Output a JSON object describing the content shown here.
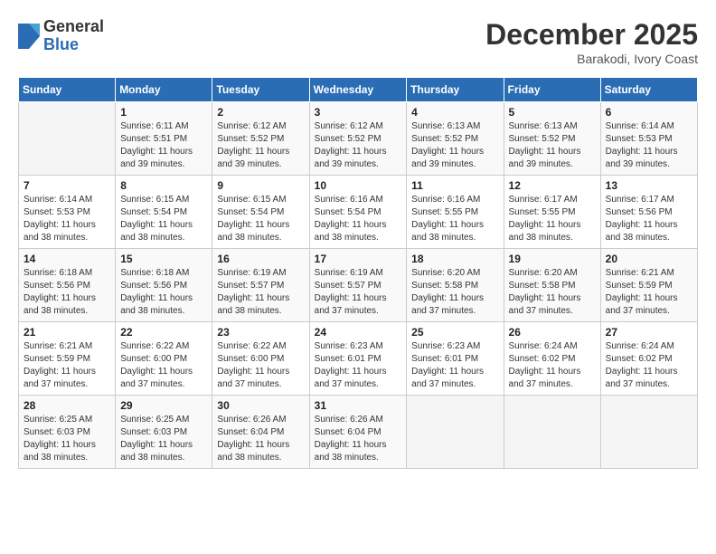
{
  "logo": {
    "general": "General",
    "blue": "Blue"
  },
  "header": {
    "month": "December 2025",
    "location": "Barakodi, Ivory Coast"
  },
  "weekdays": [
    "Sunday",
    "Monday",
    "Tuesday",
    "Wednesday",
    "Thursday",
    "Friday",
    "Saturday"
  ],
  "weeks": [
    [
      {
        "day": "",
        "info": ""
      },
      {
        "day": "1",
        "info": "Sunrise: 6:11 AM\nSunset: 5:51 PM\nDaylight: 11 hours\nand 39 minutes."
      },
      {
        "day": "2",
        "info": "Sunrise: 6:12 AM\nSunset: 5:52 PM\nDaylight: 11 hours\nand 39 minutes."
      },
      {
        "day": "3",
        "info": "Sunrise: 6:12 AM\nSunset: 5:52 PM\nDaylight: 11 hours\nand 39 minutes."
      },
      {
        "day": "4",
        "info": "Sunrise: 6:13 AM\nSunset: 5:52 PM\nDaylight: 11 hours\nand 39 minutes."
      },
      {
        "day": "5",
        "info": "Sunrise: 6:13 AM\nSunset: 5:52 PM\nDaylight: 11 hours\nand 39 minutes."
      },
      {
        "day": "6",
        "info": "Sunrise: 6:14 AM\nSunset: 5:53 PM\nDaylight: 11 hours\nand 39 minutes."
      }
    ],
    [
      {
        "day": "7",
        "info": "Sunrise: 6:14 AM\nSunset: 5:53 PM\nDaylight: 11 hours\nand 38 minutes."
      },
      {
        "day": "8",
        "info": "Sunrise: 6:15 AM\nSunset: 5:54 PM\nDaylight: 11 hours\nand 38 minutes."
      },
      {
        "day": "9",
        "info": "Sunrise: 6:15 AM\nSunset: 5:54 PM\nDaylight: 11 hours\nand 38 minutes."
      },
      {
        "day": "10",
        "info": "Sunrise: 6:16 AM\nSunset: 5:54 PM\nDaylight: 11 hours\nand 38 minutes."
      },
      {
        "day": "11",
        "info": "Sunrise: 6:16 AM\nSunset: 5:55 PM\nDaylight: 11 hours\nand 38 minutes."
      },
      {
        "day": "12",
        "info": "Sunrise: 6:17 AM\nSunset: 5:55 PM\nDaylight: 11 hours\nand 38 minutes."
      },
      {
        "day": "13",
        "info": "Sunrise: 6:17 AM\nSunset: 5:56 PM\nDaylight: 11 hours\nand 38 minutes."
      }
    ],
    [
      {
        "day": "14",
        "info": "Sunrise: 6:18 AM\nSunset: 5:56 PM\nDaylight: 11 hours\nand 38 minutes."
      },
      {
        "day": "15",
        "info": "Sunrise: 6:18 AM\nSunset: 5:56 PM\nDaylight: 11 hours\nand 38 minutes."
      },
      {
        "day": "16",
        "info": "Sunrise: 6:19 AM\nSunset: 5:57 PM\nDaylight: 11 hours\nand 38 minutes."
      },
      {
        "day": "17",
        "info": "Sunrise: 6:19 AM\nSunset: 5:57 PM\nDaylight: 11 hours\nand 37 minutes."
      },
      {
        "day": "18",
        "info": "Sunrise: 6:20 AM\nSunset: 5:58 PM\nDaylight: 11 hours\nand 37 minutes."
      },
      {
        "day": "19",
        "info": "Sunrise: 6:20 AM\nSunset: 5:58 PM\nDaylight: 11 hours\nand 37 minutes."
      },
      {
        "day": "20",
        "info": "Sunrise: 6:21 AM\nSunset: 5:59 PM\nDaylight: 11 hours\nand 37 minutes."
      }
    ],
    [
      {
        "day": "21",
        "info": "Sunrise: 6:21 AM\nSunset: 5:59 PM\nDaylight: 11 hours\nand 37 minutes."
      },
      {
        "day": "22",
        "info": "Sunrise: 6:22 AM\nSunset: 6:00 PM\nDaylight: 11 hours\nand 37 minutes."
      },
      {
        "day": "23",
        "info": "Sunrise: 6:22 AM\nSunset: 6:00 PM\nDaylight: 11 hours\nand 37 minutes."
      },
      {
        "day": "24",
        "info": "Sunrise: 6:23 AM\nSunset: 6:01 PM\nDaylight: 11 hours\nand 37 minutes."
      },
      {
        "day": "25",
        "info": "Sunrise: 6:23 AM\nSunset: 6:01 PM\nDaylight: 11 hours\nand 37 minutes."
      },
      {
        "day": "26",
        "info": "Sunrise: 6:24 AM\nSunset: 6:02 PM\nDaylight: 11 hours\nand 37 minutes."
      },
      {
        "day": "27",
        "info": "Sunrise: 6:24 AM\nSunset: 6:02 PM\nDaylight: 11 hours\nand 37 minutes."
      }
    ],
    [
      {
        "day": "28",
        "info": "Sunrise: 6:25 AM\nSunset: 6:03 PM\nDaylight: 11 hours\nand 38 minutes."
      },
      {
        "day": "29",
        "info": "Sunrise: 6:25 AM\nSunset: 6:03 PM\nDaylight: 11 hours\nand 38 minutes."
      },
      {
        "day": "30",
        "info": "Sunrise: 6:26 AM\nSunset: 6:04 PM\nDaylight: 11 hours\nand 38 minutes."
      },
      {
        "day": "31",
        "info": "Sunrise: 6:26 AM\nSunset: 6:04 PM\nDaylight: 11 hours\nand 38 minutes."
      },
      {
        "day": "",
        "info": ""
      },
      {
        "day": "",
        "info": ""
      },
      {
        "day": "",
        "info": ""
      }
    ]
  ]
}
